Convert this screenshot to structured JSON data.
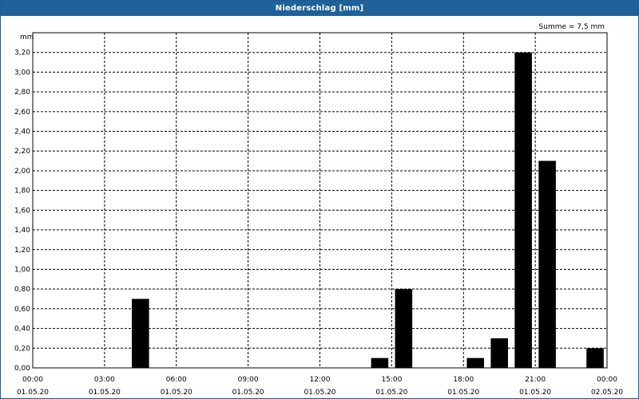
{
  "window": {
    "title": "Niederschlag [mm]"
  },
  "summary": "Summe = 7,5 mm",
  "chart_data": {
    "type": "bar",
    "ylabel": "mm",
    "ylim": [
      0,
      3.4
    ],
    "yticks": [
      "0,00",
      "0,20",
      "0,40",
      "0,60",
      "0,80",
      "1,00",
      "1,20",
      "1,40",
      "1,60",
      "1,80",
      "2,00",
      "2,20",
      "2,40",
      "2,60",
      "2,80",
      "3,00",
      "3,20"
    ],
    "xlim_hours": [
      0,
      24
    ],
    "xticks": [
      {
        "time": "00:00",
        "date": "01.05.20"
      },
      {
        "time": "03:00",
        "date": "01.05.20"
      },
      {
        "time": "06:00",
        "date": "01.05.20"
      },
      {
        "time": "09:00",
        "date": "01.05.20"
      },
      {
        "time": "12:00",
        "date": "01.05.20"
      },
      {
        "time": "15:00",
        "date": "01.05.20"
      },
      {
        "time": "18:00",
        "date": "01.05.20"
      },
      {
        "time": "21:00",
        "date": "01.05.20"
      },
      {
        "time": "00:00",
        "date": "02.05.20"
      }
    ],
    "bars": [
      {
        "x": "04:30",
        "value": 0.7
      },
      {
        "x": "14:30",
        "value": 0.1
      },
      {
        "x": "15:30",
        "value": 0.8
      },
      {
        "x": "18:30",
        "value": 0.1
      },
      {
        "x": "19:30",
        "value": 0.3
      },
      {
        "x": "20:30",
        "value": 3.2
      },
      {
        "x": "21:30",
        "value": 2.1
      },
      {
        "x": "23:30",
        "value": 0.2
      }
    ],
    "grid": true,
    "bar_color": "#000000"
  }
}
